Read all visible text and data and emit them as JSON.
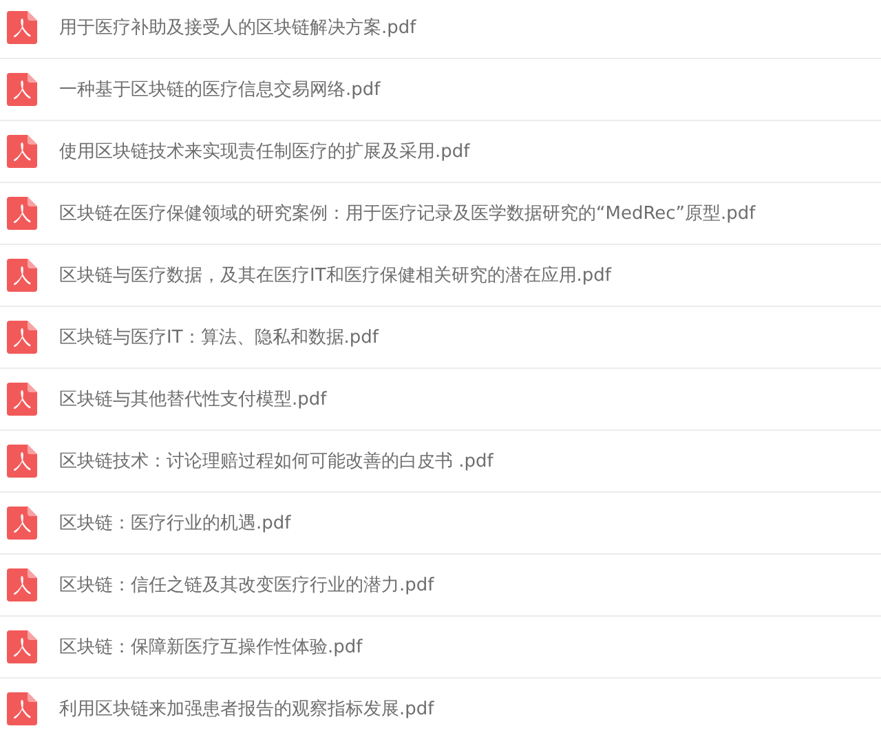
{
  "files": [
    {
      "name": "用于医疗补助及接受人的区块链解决方案.pdf"
    },
    {
      "name": "一种基于区块链的医疗信息交易网络.pdf"
    },
    {
      "name": "使用区块链技术来实现责任制医疗的扩展及采用.pdf"
    },
    {
      "name": "区块链在医疗保健领域的研究案例：用于医疗记录及医学数据研究的“MedRec”原型.pdf"
    },
    {
      "name": "区块链与医疗数据，及其在医疗IT和医疗保健相关研究的潜在应用.pdf"
    },
    {
      "name": "区块链与医疗IT：算法、隐私和数据.pdf"
    },
    {
      "name": "区块链与其他替代性支付模型.pdf"
    },
    {
      "name": "区块链技术：讨论理赔过程如何可能改善的白皮书 .pdf"
    },
    {
      "name": "区块链：医疗行业的机遇.pdf"
    },
    {
      "name": "区块链：信任之链及其改变医疗行业的潜力.pdf"
    },
    {
      "name": "区块链：保障新医疗互操作性体验.pdf"
    },
    {
      "name": "利用区块链来加强患者报告的观察指标发展.pdf"
    }
  ]
}
